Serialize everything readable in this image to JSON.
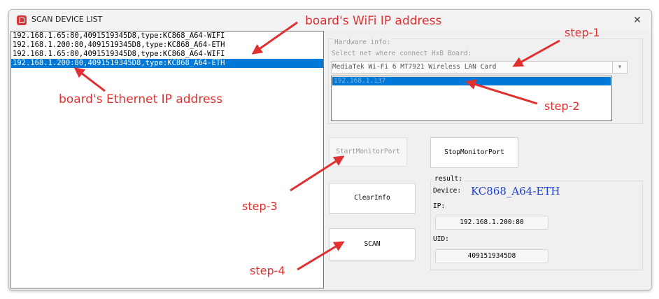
{
  "window": {
    "title": "SCAN DEVICE LIST",
    "close_glyph": "✕"
  },
  "device_list": [
    "192.168.1.65:80,4091519345D8,type:KC868_A64-WIFI",
    "192.168.1.200:80,4091519345D8,type:KC868_A64-ETH",
    "192.168.1.65:80,4091519345D8,type:KC868_A64-WIFI",
    "192.168.1.200:80,4091519345D8,type:KC868_A64-ETH"
  ],
  "selected_device_index": 3,
  "hardware": {
    "legend": "Hardware info:",
    "prompt": "Select net where connect HxB Board:",
    "selected_net": "MediaTek Wi-Fi 6 MT7921 Wireless LAN Card",
    "ip_list": [
      "192.168.1.137"
    ]
  },
  "buttons": {
    "start_monitor": "StartMonitorPort",
    "stop_monitor": "StopMonitorPort",
    "clear_info": "ClearInfo",
    "scan": "SCAN"
  },
  "result": {
    "legend": "result:",
    "device_label": "Device:",
    "device_value": "KC868_A64-ETH",
    "ip_label": "IP:",
    "ip_value": "192.168.1.200:80",
    "uid_label": "UID:",
    "uid_value": "4091519345D8"
  },
  "annotations": {
    "wifi_ip": "board's WiFi IP address",
    "eth_ip": "board's Ethernet IP address",
    "step1": "step-1",
    "step2": "step-2",
    "step3": "step-3",
    "step4": "step-4"
  },
  "colors": {
    "annotation": "#e03030",
    "selection": "#0078d7",
    "device_value": "#1a3fd6"
  }
}
